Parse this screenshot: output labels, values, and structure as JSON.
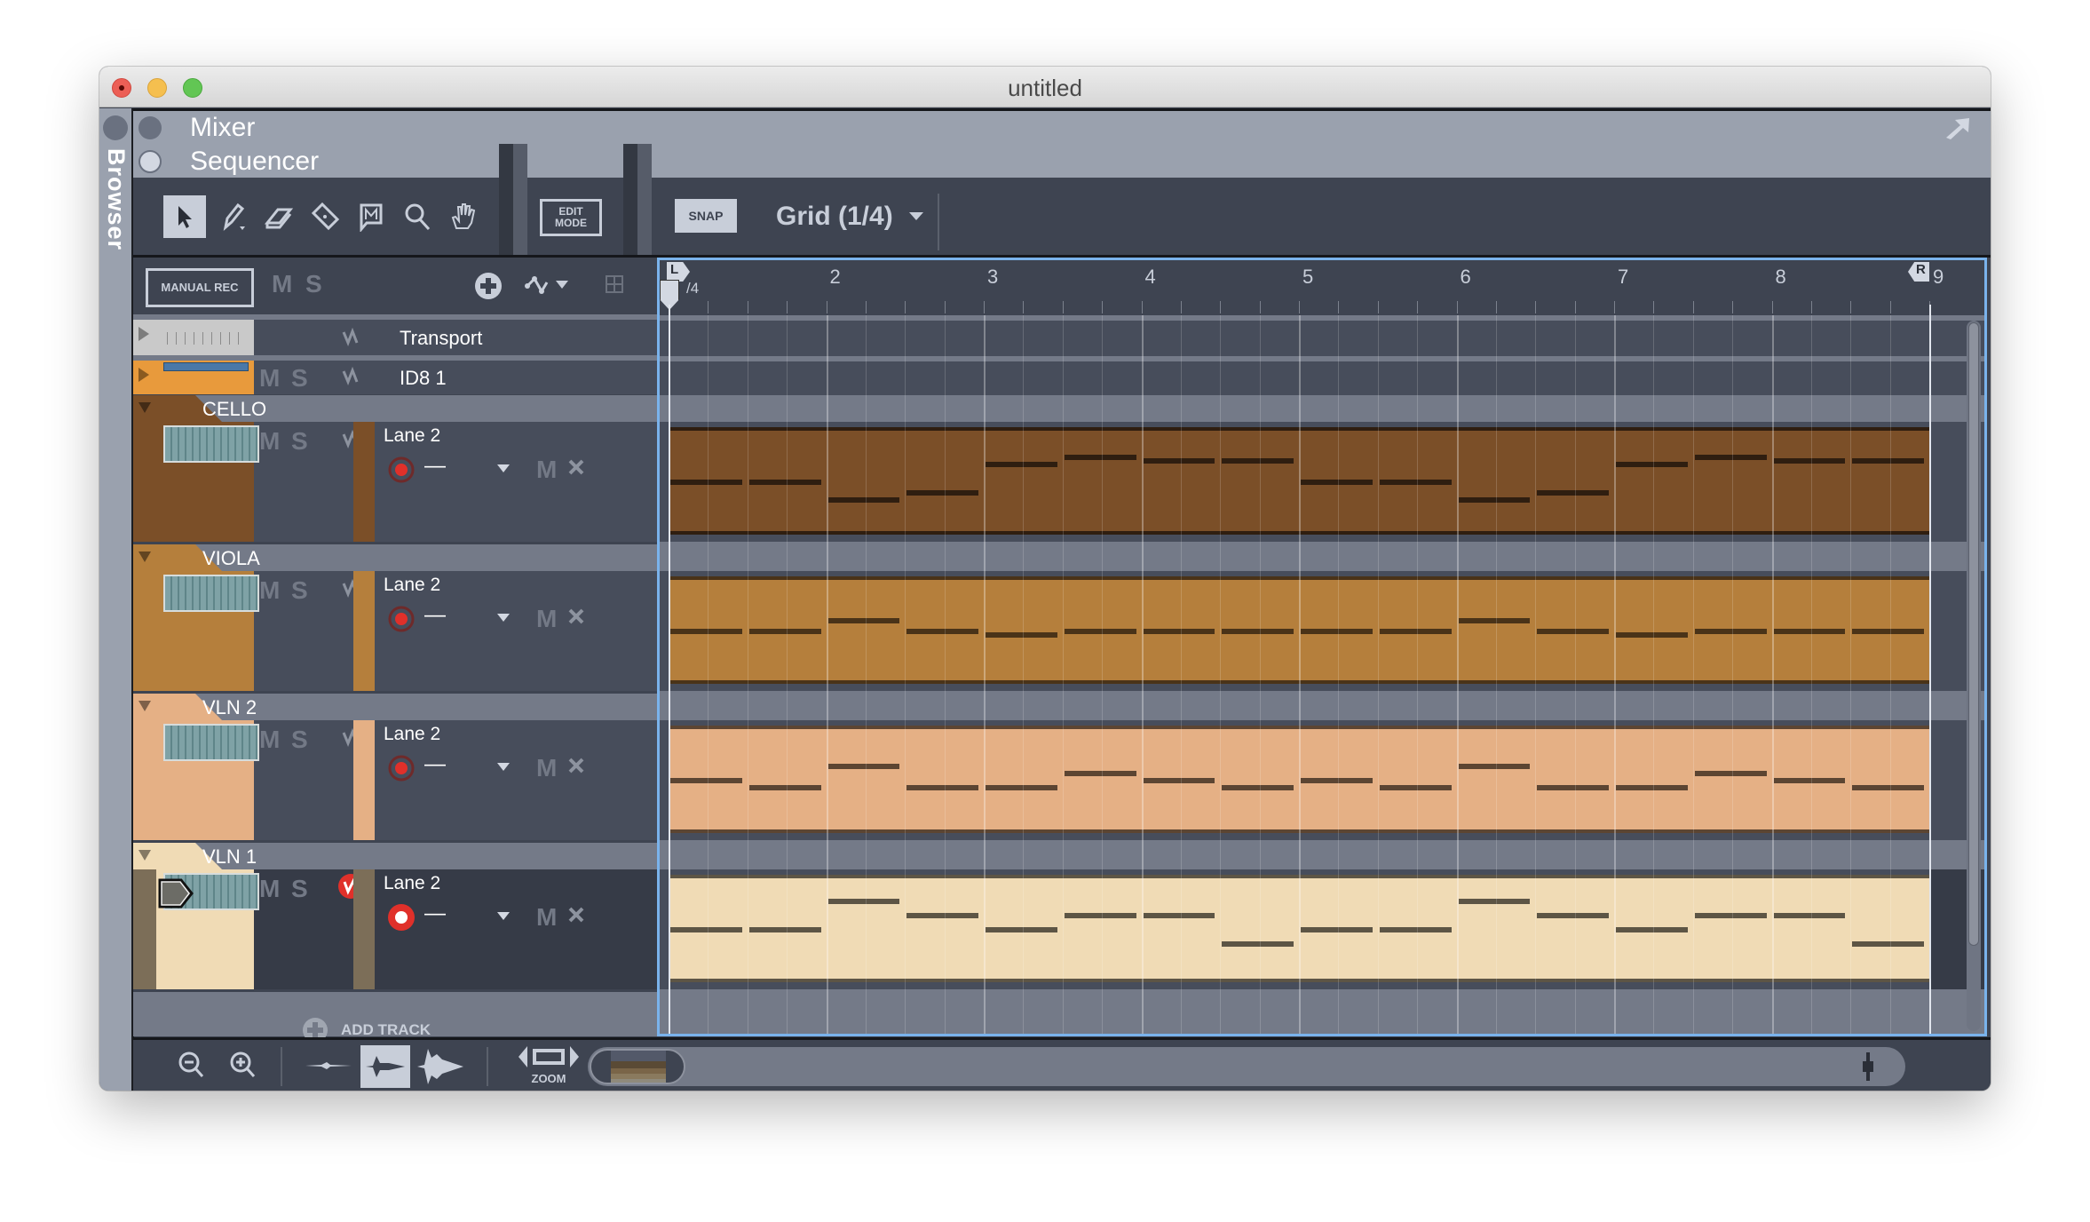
{
  "window": {
    "title": "untitled",
    "traffic_lights": [
      {
        "name": "close",
        "color": "#ec5f56"
      },
      {
        "name": "minimize",
        "color": "#f5bf4f"
      },
      {
        "name": "zoom",
        "color": "#62c654"
      }
    ]
  },
  "sidebar": {
    "browser_label": "Browser"
  },
  "sections": {
    "mixer_label": "Mixer",
    "sequencer_label": "Sequencer",
    "detach_icon": "arrow-up-right-icon"
  },
  "toolbar": {
    "tools": [
      {
        "name": "select-tool",
        "icon": "arrow-pointer-icon",
        "active": true
      },
      {
        "name": "pencil-tool",
        "icon": "pencil-icon",
        "active": false
      },
      {
        "name": "eraser-tool",
        "icon": "eraser-icon",
        "active": false
      },
      {
        "name": "razor-tool",
        "icon": "razor-icon",
        "active": false
      },
      {
        "name": "mute-tool",
        "icon": "mute-speech-icon",
        "active": false
      },
      {
        "name": "magnify-tool",
        "icon": "magnifier-icon",
        "active": false
      },
      {
        "name": "hand-tool",
        "icon": "hand-icon",
        "active": false
      }
    ],
    "edit_mode_line1": "EDIT",
    "edit_mode_line2": "MODE",
    "snap_label": "SNAP",
    "grid_label": "Grid (1/4)"
  },
  "track_header": {
    "manual_rec_label": "MANUAL REC",
    "mute_label": "M",
    "solo_label": "S"
  },
  "ruler": {
    "bars": [
      "2",
      "3",
      "4",
      "5",
      "6",
      "7",
      "8",
      "9"
    ],
    "left_locator": "L",
    "right_locator": "R",
    "time_signature": "/4",
    "subdivisions_per_bar": 4
  },
  "tracks": [
    {
      "name": "Transport",
      "type": "transport",
      "color": "#c9c9c9"
    },
    {
      "name": "ID8 1",
      "type": "instrument-collapsed",
      "color": "#e89a3c",
      "mute": "M",
      "solo": "S"
    }
  ],
  "instrument_tracks": [
    {
      "name": "CELLO",
      "color": "#7b4f28",
      "note_color": "#2f1e10",
      "lane": "Lane 2",
      "rec_value": "—",
      "lane_mute": "M",
      "automation_active": false,
      "record_enabled": false,
      "notes": [
        0,
        0,
        -5,
        -3,
        5,
        7,
        6,
        6,
        0,
        0,
        -5,
        -3,
        5,
        7,
        6,
        6
      ]
    },
    {
      "name": "VIOLA",
      "color": "#b57f3c",
      "note_color": "#4a3318",
      "lane": "Lane 2",
      "rec_value": "—",
      "lane_mute": "M",
      "automation_active": false,
      "record_enabled": false,
      "notes": [
        0,
        0,
        3,
        0,
        -1,
        0,
        0,
        0,
        0,
        0,
        3,
        0,
        -1,
        0,
        0,
        0
      ]
    },
    {
      "name": "VLN 2",
      "color": "#e5b085",
      "note_color": "#5c4532",
      "lane": "Lane 2",
      "rec_value": "—",
      "lane_mute": "M",
      "automation_active": false,
      "record_enabled": false,
      "notes": [
        0,
        -2,
        4,
        -2,
        -2,
        2,
        0,
        -2,
        0,
        -2,
        4,
        -2,
        -2,
        2,
        0,
        -2
      ]
    },
    {
      "name": "VLN 1",
      "color": "#f0dbb5",
      "note_color": "#5d5545",
      "lane": "Lane 2",
      "rec_value": "—",
      "lane_mute": "M",
      "automation_active": true,
      "record_enabled": true,
      "notes": [
        0,
        0,
        8,
        4,
        0,
        4,
        4,
        -4,
        0,
        0,
        8,
        4,
        0,
        4,
        4,
        -4
      ]
    }
  ],
  "add_track_label": "ADD TRACK",
  "bottombar": {
    "zoom_label": "ZOOM",
    "waveform_modes": [
      "waveform-small-icon",
      "waveform-medium-icon",
      "waveform-large-icon"
    ],
    "active_waveform_mode": 1
  },
  "colors": {
    "accent_blue": "#7ab3ec",
    "record_red": "#e0302a",
    "panel_dark": "#3e4451",
    "panel_light": "#9aa1ae",
    "icon_light": "#c8ced9"
  }
}
